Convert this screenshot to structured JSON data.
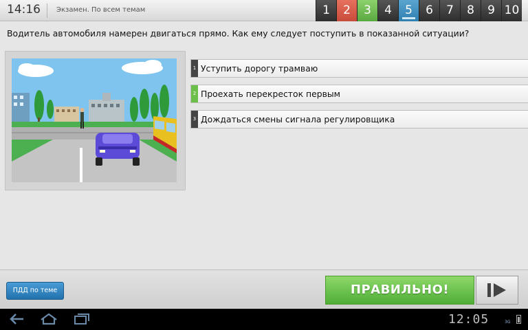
{
  "header": {
    "time": "14:16",
    "section": "Экзамен. По всем темам",
    "questions": [
      {
        "label": "1",
        "status": "unanswered"
      },
      {
        "label": "2",
        "status": "wrong"
      },
      {
        "label": "3",
        "status": "correct"
      },
      {
        "label": "4",
        "status": "unanswered"
      },
      {
        "label": "5",
        "status": "current"
      },
      {
        "label": "6",
        "status": "unanswered"
      },
      {
        "label": "7",
        "status": "unanswered"
      },
      {
        "label": "8",
        "status": "unanswered"
      },
      {
        "label": "9",
        "status": "unanswered"
      },
      {
        "label": "10",
        "status": "unanswered"
      }
    ]
  },
  "question": {
    "text": "Водитель автомобиля намерен двигаться прямо. Как ему следует поступить в показанной ситуации?"
  },
  "answers": [
    {
      "number": "1",
      "text": "Уступить дорогу трамваю",
      "marker_color": "#444444"
    },
    {
      "number": "2",
      "text": "Проехать перекресток первым",
      "marker_color": "#6cbf4a"
    },
    {
      "number": "3",
      "text": "Дождаться смены сигнала регулировщика",
      "marker_color": "#444444"
    }
  ],
  "footer": {
    "rules_button": "ПДД по теме",
    "result": "ПРАВИЛЬНО!",
    "next_icon": "next-arrow-icon"
  },
  "system_bar": {
    "time": "12:05",
    "signal": "3G",
    "icons": [
      "back-icon",
      "home-icon",
      "recent-apps-icon",
      "battery-icon"
    ]
  },
  "colors": {
    "wrong": "#c84b3a",
    "correct": "#5aa840",
    "current": "#2f7fb0",
    "result_green": "#4fae37",
    "rules_blue": "#2172ad"
  }
}
